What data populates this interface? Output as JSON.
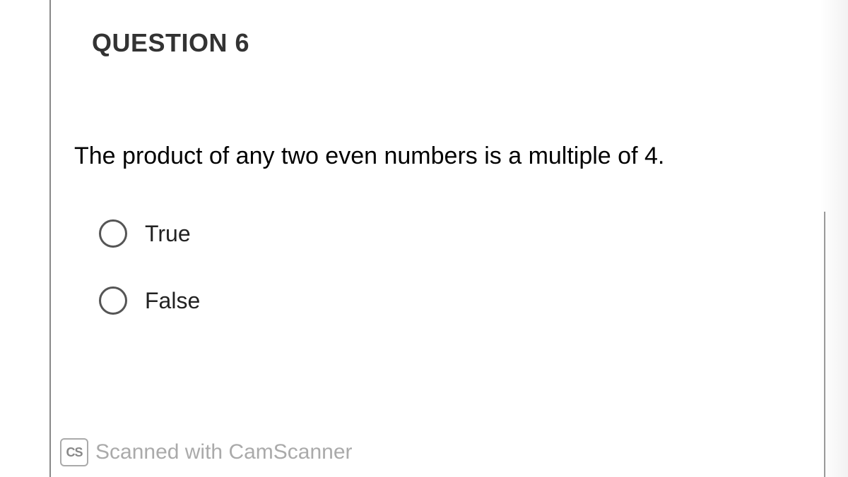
{
  "question": {
    "heading": "QUESTION 6",
    "prompt": "The product of any two even numbers is a multiple of 4.",
    "options": [
      {
        "label": "True"
      },
      {
        "label": "False"
      }
    ]
  },
  "watermark": {
    "badge": "CS",
    "text": "Scanned with CamScanner"
  }
}
